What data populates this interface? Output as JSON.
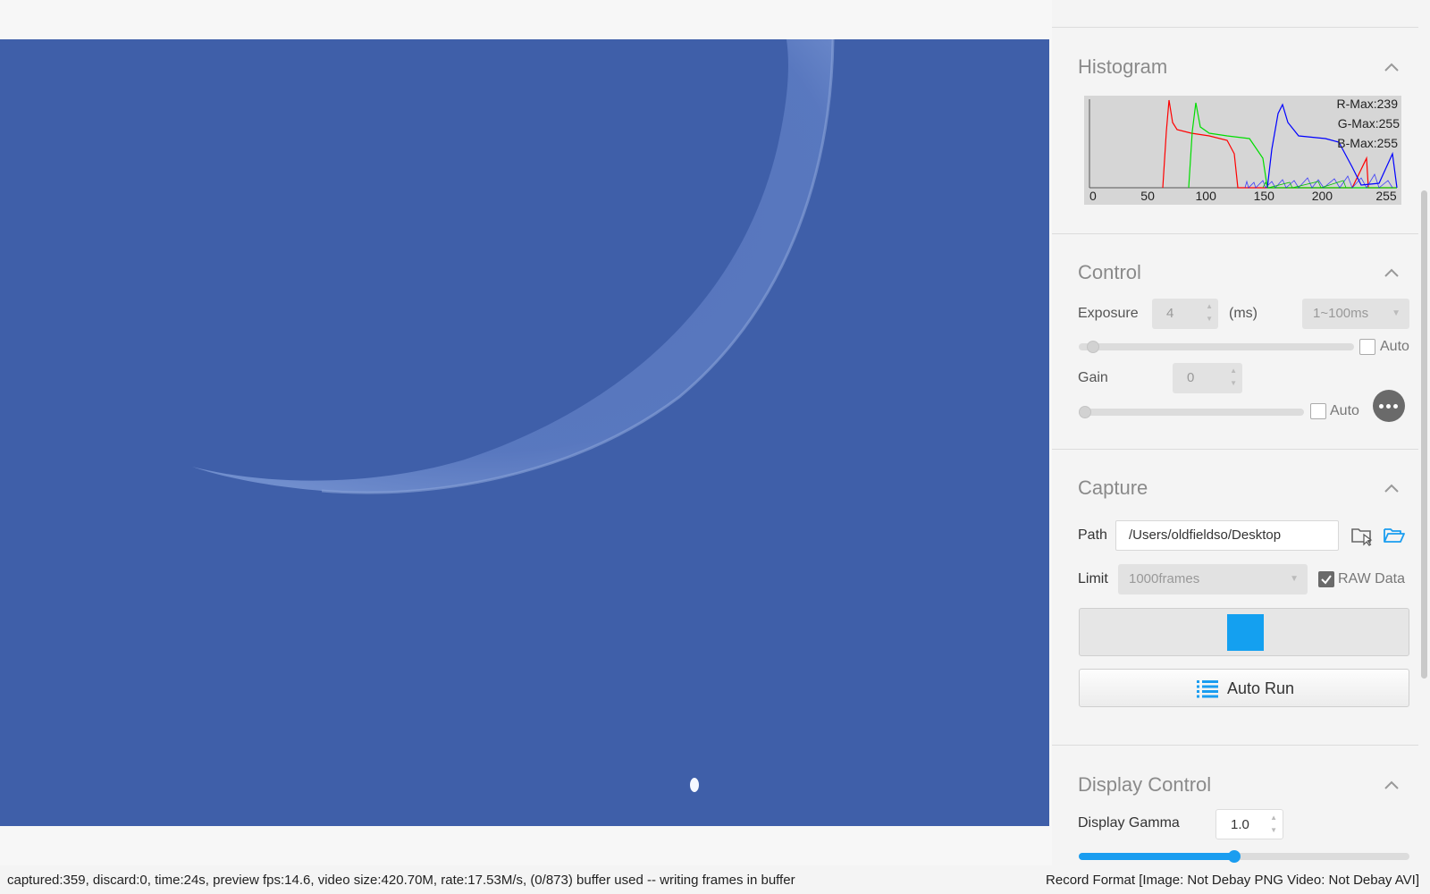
{
  "histogram": {
    "title": "Histogram",
    "r_max": "R-Max:239",
    "g_max": "G-Max:255",
    "b_max": "B-Max:255",
    "x_ticks": [
      "0",
      "50",
      "100",
      "150",
      "200",
      "255"
    ],
    "colors": {
      "r": "#ff0000",
      "g": "#00dd00",
      "b": "#0000ff"
    }
  },
  "control": {
    "title": "Control",
    "exposure_label": "Exposure",
    "exposure_value": "4",
    "exposure_unit": "(ms)",
    "exposure_range": "1~100ms",
    "exposure_auto_label": "Auto",
    "exposure_auto_checked": false,
    "exposure_level": 0.03,
    "gain_label": "Gain",
    "gain_value": "0",
    "gain_auto_label": "Auto",
    "gain_auto_checked": false,
    "gain_level": 0.0
  },
  "capture": {
    "title": "Capture",
    "path_label": "Path",
    "path_value": "/Users/oldfieldso/Desktop",
    "limit_label": "Limit",
    "limit_value": "1000frames",
    "raw_label": "RAW Data",
    "raw_checked": true,
    "autorun_label": "Auto Run"
  },
  "display": {
    "title": "Display Control",
    "gamma_label": "Display Gamma",
    "gamma_value": "1.0",
    "gamma_level": 0.47
  },
  "status": {
    "left": "captured:359, discard:0, time:24s, preview fps:14.6, video size:420.70M, rate:17.53M/s, (0/873) buffer used -- writing frames in buffer",
    "right": "Record Format [Image: Not Debay PNG Video: Not Debay AVI]"
  },
  "accent_color": "#14a0f0"
}
